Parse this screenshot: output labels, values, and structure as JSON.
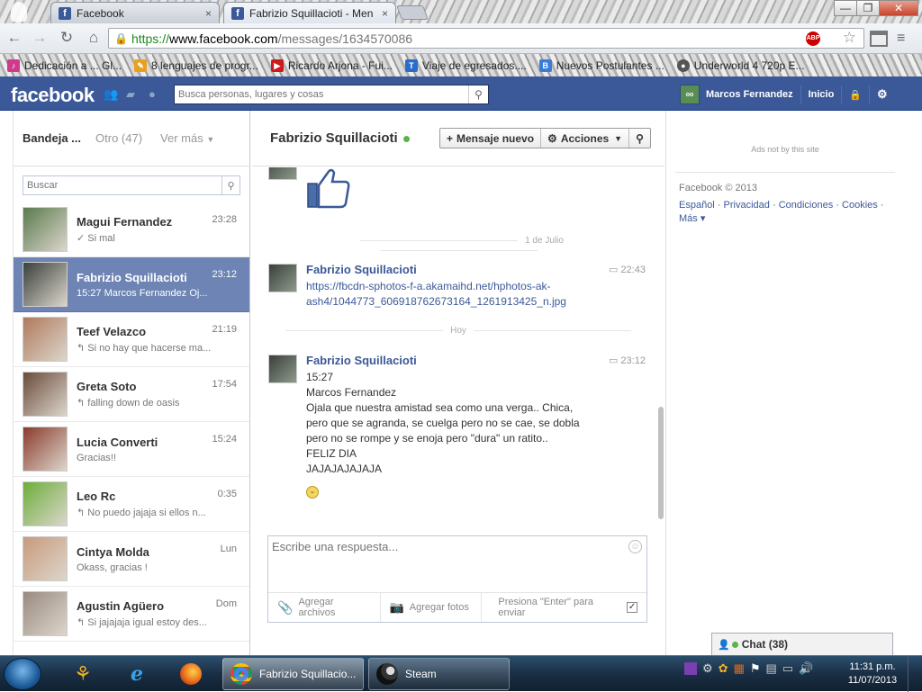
{
  "browser": {
    "tabs": [
      {
        "title": "Facebook",
        "active": false
      },
      {
        "title": "Fabrizio Squillacioti - Men",
        "active": true
      }
    ],
    "tab_close": "×",
    "window_controls": {
      "minimize": "—",
      "maximize": "❐",
      "close": "✕"
    },
    "url": {
      "scheme": "https://",
      "domain": "www.facebook.com",
      "path": "/messages/1634570086"
    },
    "abp_label": "ABP",
    "bookmarks": [
      {
        "label": "Dedicación a ... Gl...",
        "icon": "music-icon",
        "color": "#d03a8c"
      },
      {
        "label": "8 lenguajes de progr...",
        "icon": "bookmark-icon",
        "color": "#e8a020"
      },
      {
        "label": "Ricardo Arjona - Fui...",
        "icon": "youtube-icon",
        "color": "#cc1b1b"
      },
      {
        "label": "Viaje de egresados....",
        "icon": "t-icon",
        "color": "#2a6cc7"
      },
      {
        "label": "Nuevos Postulantes ...",
        "icon": "b-icon",
        "color": "#3a7dd8"
      },
      {
        "label": "Underworld 4 720p E...",
        "icon": "chat-icon",
        "color": "#555555"
      }
    ]
  },
  "fb": {
    "logo": "facebook",
    "search_placeholder": "Busca personas, lugares y cosas",
    "user_name": "Marcos Fernandez",
    "home_label": "Inicio"
  },
  "inbox": {
    "tab_inbox": "Bandeja ...",
    "tab_other": "Otro (47)",
    "tab_more": "Ver más",
    "search_placeholder": "Buscar",
    "threads": [
      {
        "name": "Magui Fernandez",
        "time": "23:28",
        "snippet": "✓ Si mal",
        "selected": false,
        "thumb": "#5b7a4e"
      },
      {
        "name": "Fabrizio Squillacioti",
        "time": "23:12",
        "snippet": "15:27 Marcos Fernandez Oj...",
        "selected": true,
        "thumb": "#39403a"
      },
      {
        "name": "Teef Velazco",
        "time": "21:19",
        "snippet": "↰ Si no hay que hacerse ma...",
        "selected": false,
        "thumb": "#b07a5c"
      },
      {
        "name": "Greta Soto",
        "time": "17:54",
        "snippet": "↰ falling down de oasis",
        "selected": false,
        "thumb": "#6a4b3a"
      },
      {
        "name": "Lucia Converti",
        "time": "15:24",
        "snippet": "Gracias!!",
        "selected": false,
        "thumb": "#8a3b2c"
      },
      {
        "name": "Leo Rc",
        "time": "0:35",
        "snippet": "↰ No puedo jajaja si ellos n...",
        "selected": false,
        "thumb": "#6cae3a"
      },
      {
        "name": "Cintya Molda",
        "time": "Lun",
        "snippet": "Okass, gracias !",
        "selected": false,
        "thumb": "#c89a7a"
      },
      {
        "name": "Agustin Agüero",
        "time": "Dom",
        "snippet": "↰ Si jajajaja igual estoy des...",
        "selected": false,
        "thumb": "#9a8a80"
      }
    ]
  },
  "conversation": {
    "title": "Fabrizio Squillacioti",
    "new_message": "Mensaje nuevo",
    "actions": "Acciones",
    "day1": "1 de Julio",
    "day2": "Hoy",
    "msg1": {
      "sender": "Fabrizio Squillacioti",
      "time": "22:43",
      "line1": "https://fbcdn-sphotos-f-a.akamaihd.net/hphotos-ak-",
      "line2": "ash4/1044773_606918762673164_1261913425_n.jpg"
    },
    "msg2": {
      "sender": "Fabrizio Squillacioti",
      "time": "23:12",
      "lines": [
        "15:27",
        "Marcos Fernandez",
        "Ojala que nuestra amistad sea como una verga.. Chica,",
        "pero que se agranda, se cuelga pero no se cae, se dobla",
        "pero no se rompe y se enoja pero \"dura\" un ratito..",
        "FELIZ DIA",
        "JAJAJAJAJAJA"
      ]
    },
    "reply_placeholder": "Escribe una respuesta...",
    "attach_files": "Agregar archivos",
    "attach_photos": "Agregar fotos",
    "enter_hint": "Presiona \"Enter\" para enviar"
  },
  "sidebar": {
    "ads": "Ads not by this site",
    "copyright": "Facebook © 2013",
    "links": [
      "Español",
      "Privacidad",
      "Condiciones",
      "Cookies",
      "Más ▾"
    ],
    "chat_label": "Chat (38)"
  },
  "taskbar": {
    "tasks": [
      {
        "label": "Fabrizio Squillacio...",
        "icon": "chrome-icon"
      },
      {
        "label": "Steam",
        "icon": "steam-icon"
      }
    ],
    "time": "11:31 p.m.",
    "date": "11/07/2013"
  }
}
